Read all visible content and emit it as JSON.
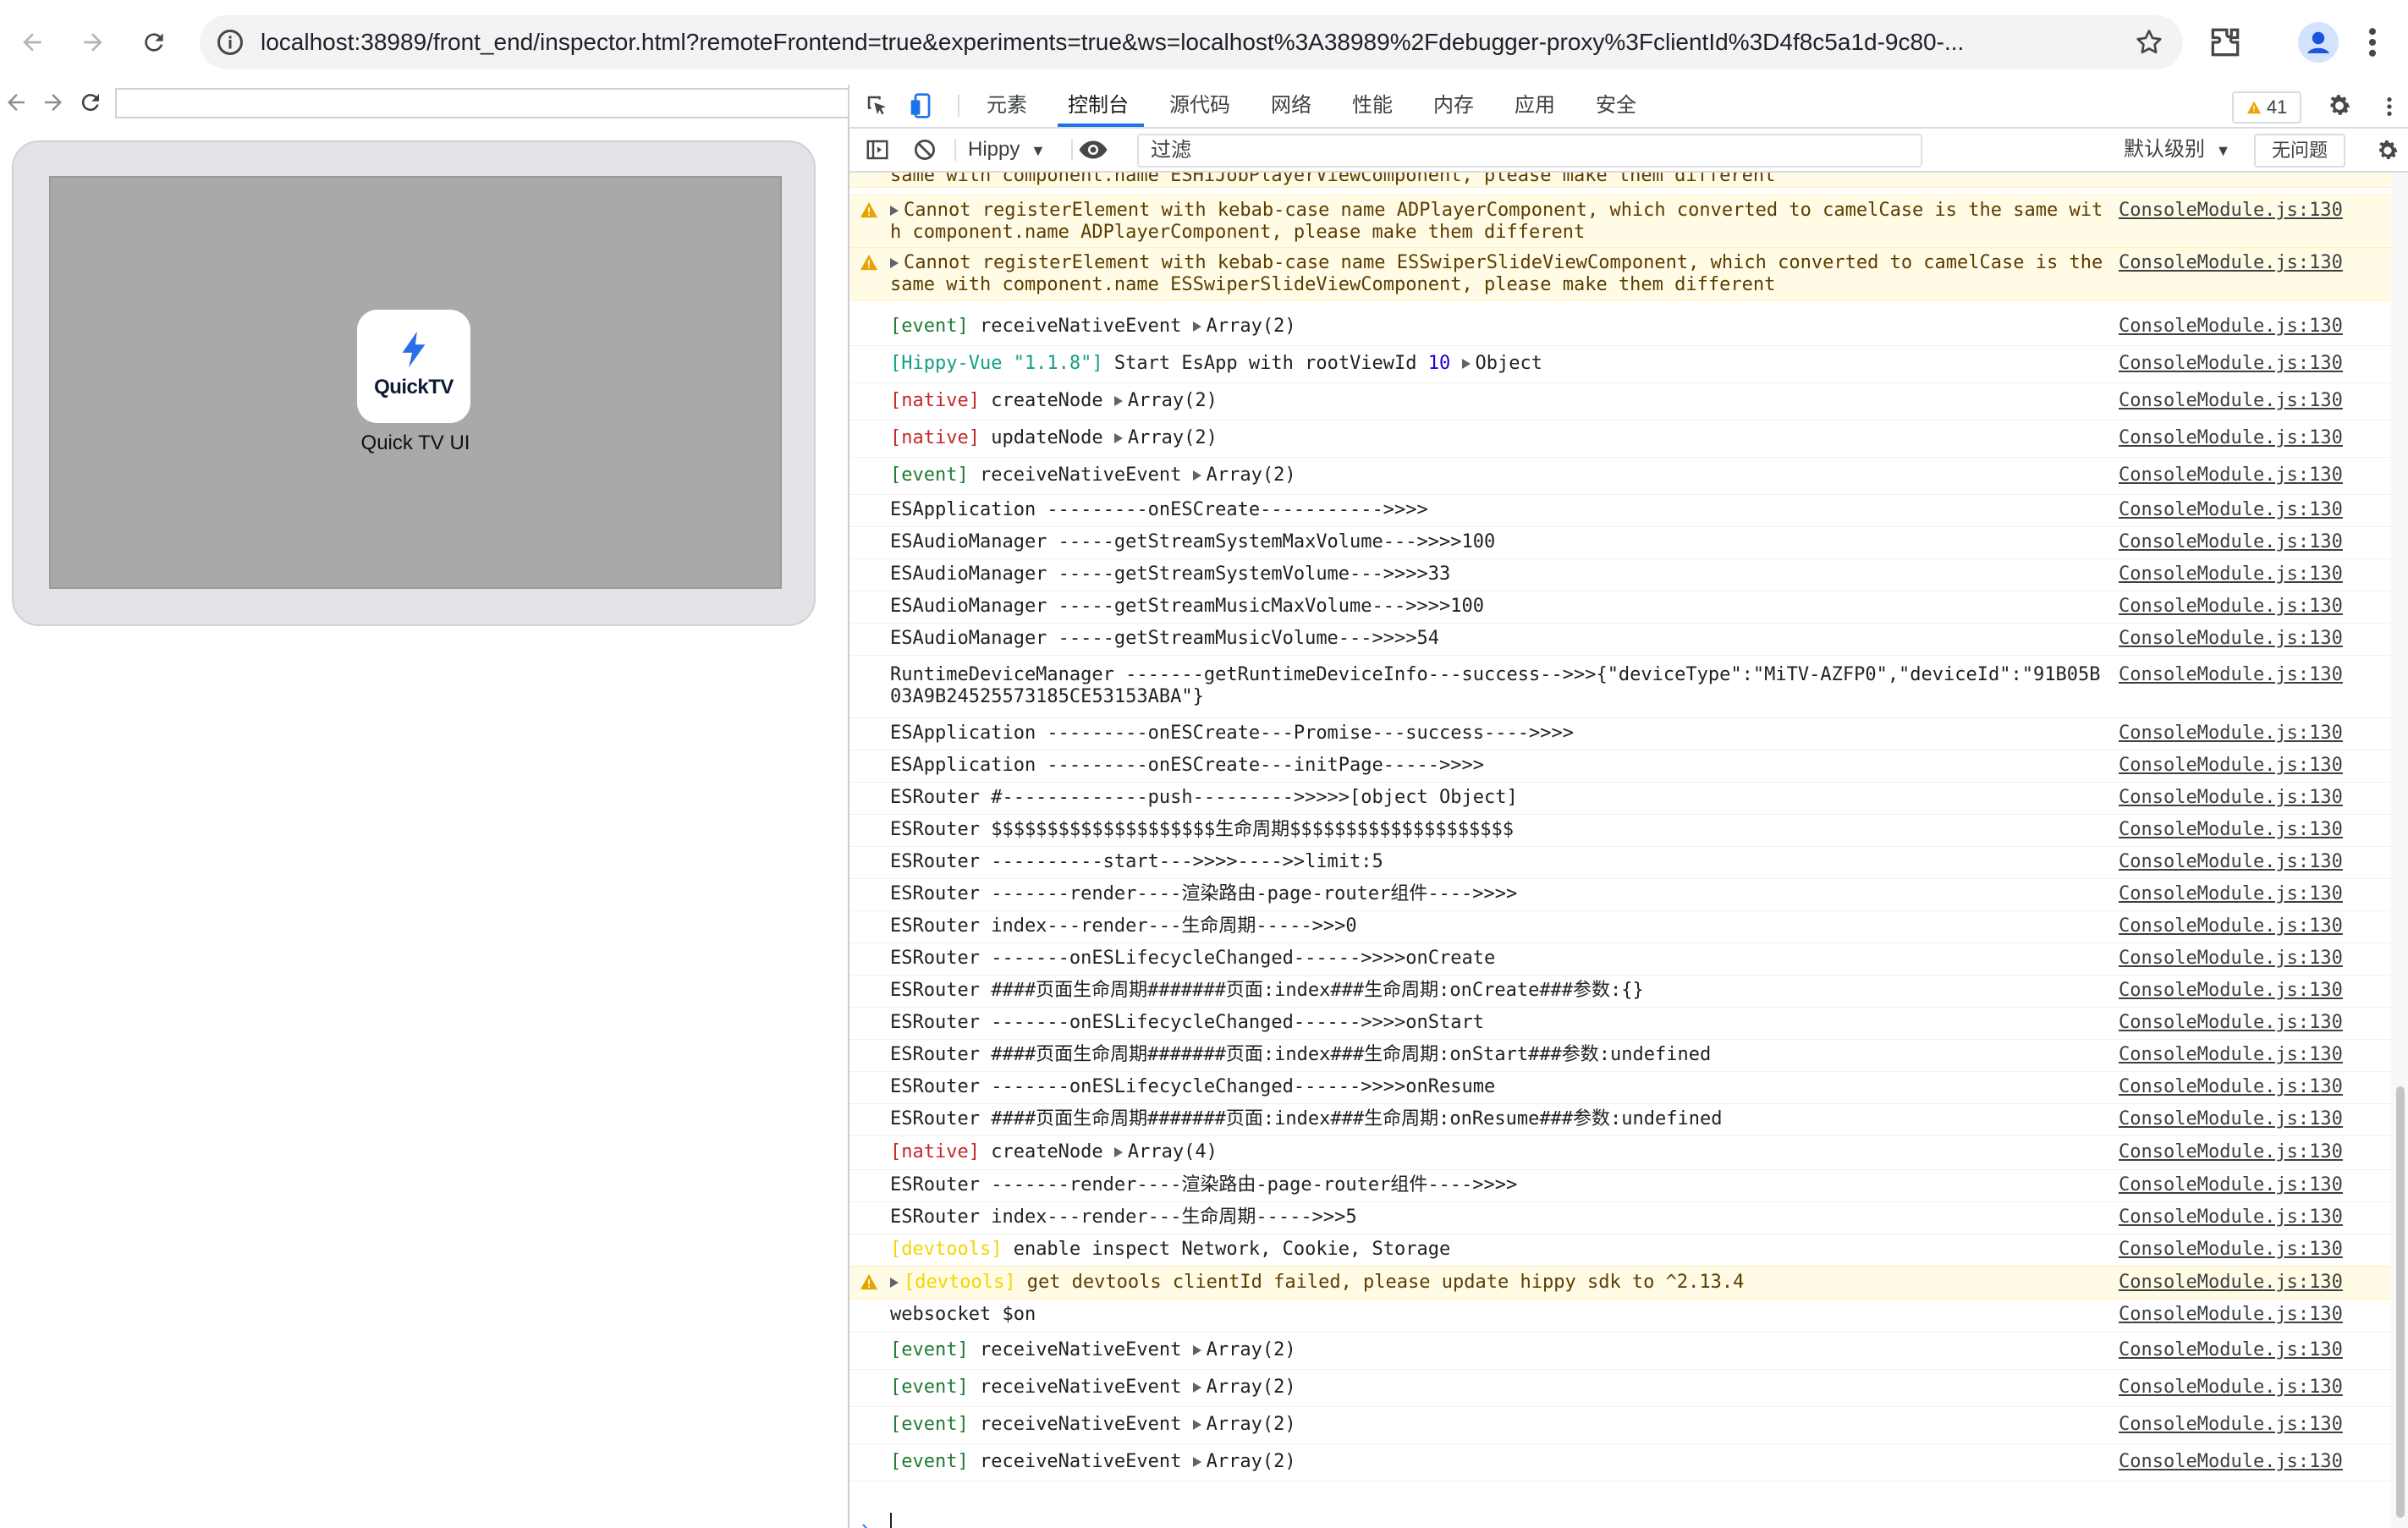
{
  "browser": {
    "url": "localhost:38989/front_end/inspector.html?remoteFrontend=true&experiments=true&ws=localhost%3A38989%2Fdebugger-proxy%3FclientId%3D4f8c5a1d-9c80-..."
  },
  "left_panel": {
    "app_icon_text": "QuickTV",
    "app_label": "Quick TV UI"
  },
  "devtools": {
    "tabs": [
      "元素",
      "控制台",
      "源代码",
      "网络",
      "性能",
      "内存",
      "应用",
      "安全"
    ],
    "active_tab": "控制台",
    "issues_count": "41",
    "context": "Hippy",
    "filter_placeholder": "过滤",
    "level": "默认级别",
    "no_issues": "无问题"
  },
  "console": {
    "source": "ConsoleModule.js:130",
    "top_partial": "same with component.name ESHiJobPlayerViewComponent, please make them different",
    "rows": [
      {
        "type": "warn",
        "text": "Cannot registerElement with kebab-case name ADPlayerComponent, which converted to camelCase is the same with component.name ADPlayerComponent, please make them different"
      },
      {
        "type": "warn",
        "text": "Cannot registerElement with kebab-case name ESSwiperSlideViewComponent, which converted to camelCase is the same with component.name ESSwiperSlideViewComponent, please make them different"
      },
      {
        "type": "event",
        "tag": "[event]",
        "text": "receiveNativeEvent",
        "arg": "Array(2)"
      },
      {
        "type": "hippy",
        "tag": "[Hippy-Vue \"1.1.8\"]",
        "text": "Start EsApp with rootViewId",
        "num": "10",
        "arg": "Object"
      },
      {
        "type": "native",
        "tag": "[native]",
        "text": "createNode",
        "arg": "Array(2)"
      },
      {
        "type": "native",
        "tag": "[native]",
        "text": "updateNode",
        "arg": "Array(2)"
      },
      {
        "type": "event",
        "tag": "[event]",
        "text": "receiveNativeEvent",
        "arg": "Array(2)"
      },
      {
        "type": "log",
        "text": "ESApplication ---------onESCreate----------->>>>"
      },
      {
        "type": "log",
        "text": "ESAudioManager -----getStreamSystemMaxVolume--->>>>100"
      },
      {
        "type": "log",
        "text": "ESAudioManager -----getStreamSystemVolume--->>>>33"
      },
      {
        "type": "log",
        "text": "ESAudioManager -----getStreamMusicMaxVolume--->>>>100"
      },
      {
        "type": "log",
        "text": "ESAudioManager -----getStreamMusicVolume--->>>>54"
      },
      {
        "type": "log",
        "text": "RuntimeDeviceManager -------getRuntimeDeviceInfo---success-->>>{\"deviceType\":\"MiTV-AZFP0\",\"deviceId\":\"91B05B03A9B24525573185CE53153ABA\"}"
      },
      {
        "type": "log",
        "text": "ESApplication ---------onESCreate---Promise---success---->>>>"
      },
      {
        "type": "log",
        "text": "ESApplication ---------onESCreate---initPage----->>>>"
      },
      {
        "type": "log",
        "text": "ESRouter #-------------push--------->>>>>[object Object]"
      },
      {
        "type": "log",
        "text": "ESRouter $$$$$$$$$$$$$$$$$$$$生命周期$$$$$$$$$$$$$$$$$$$$"
      },
      {
        "type": "log",
        "text": "ESRouter ----------start--->>>>---->>limit:5"
      },
      {
        "type": "log",
        "text": "ESRouter -------render----渲染路由-page-router组件---->>>>"
      },
      {
        "type": "log",
        "text": "ESRouter index---render---生命周期----->>>0"
      },
      {
        "type": "log",
        "text": "ESRouter -------onESLifecycleChanged------>>>>onCreate"
      },
      {
        "type": "log",
        "text": "ESRouter ####页面生命周期#######页面:index###生命周期:onCreate###参数:{}"
      },
      {
        "type": "log",
        "text": "ESRouter -------onESLifecycleChanged------>>>>onStart"
      },
      {
        "type": "log",
        "text": "ESRouter ####页面生命周期#######页面:index###生命周期:onStart###参数:undefined"
      },
      {
        "type": "log",
        "text": "ESRouter -------onESLifecycleChanged------>>>>onResume"
      },
      {
        "type": "log",
        "text": "ESRouter ####页面生命周期#######页面:index###生命周期:onResume###参数:undefined"
      },
      {
        "type": "native",
        "tag": "[native]",
        "text": "createNode",
        "arg": "Array(4)"
      },
      {
        "type": "log",
        "text": "ESRouter -------render----渲染路由-page-router组件---->>>>"
      },
      {
        "type": "log",
        "text": "ESRouter index---render---生命周期----->>>5"
      },
      {
        "type": "devtools",
        "tag": "[devtools]",
        "text": "enable inspect Network, Cookie, Storage"
      },
      {
        "type": "warn-devtools",
        "tag": "[devtools]",
        "text": "get devtools clientId failed, please update hippy sdk to ^2.13.4"
      },
      {
        "type": "log",
        "text": "websocket $on"
      },
      {
        "type": "event",
        "tag": "[event]",
        "text": "receiveNativeEvent",
        "arg": "Array(2)"
      },
      {
        "type": "event",
        "tag": "[event]",
        "text": "receiveNativeEvent",
        "arg": "Array(2)"
      },
      {
        "type": "event",
        "tag": "[event]",
        "text": "receiveNativeEvent",
        "arg": "Array(2)"
      },
      {
        "type": "event",
        "tag": "[event]",
        "text": "receiveNativeEvent",
        "arg": "Array(2)"
      }
    ]
  }
}
